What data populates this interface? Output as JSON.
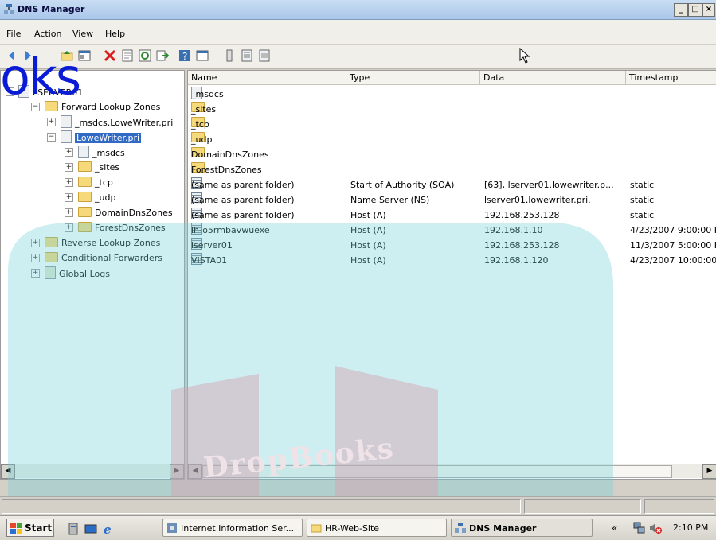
{
  "window": {
    "title": "DNS Manager",
    "minimize": "_",
    "maximize": "□",
    "close": "×"
  },
  "menu": {
    "items": [
      "File",
      "Action",
      "View",
      "Help"
    ]
  },
  "toolbar": {
    "icons": [
      "back-icon",
      "forward-icon",
      "up-folder-icon",
      "show-hide-tree-icon",
      "delete-icon",
      "properties-icon",
      "refresh-icon",
      "export-list-icon",
      "help-icon",
      "console-icon",
      "server-icon",
      "zone-icon",
      "record-icon"
    ]
  },
  "tree": {
    "items": [
      {
        "label": "LSERVER01",
        "expander": "−"
      },
      {
        "label": "Forward Lookup Zones",
        "expander": "−"
      },
      {
        "label": "_msdcs.LoweWriter.pri",
        "expander": "+"
      },
      {
        "label": "LoweWriter.pri",
        "expander": "−"
      },
      {
        "label": "_msdcs",
        "expander": "+"
      },
      {
        "label": "_sites",
        "expander": "+"
      },
      {
        "label": "_tcp",
        "expander": "+"
      },
      {
        "label": "_udp",
        "expander": "+"
      },
      {
        "label": "DomainDnsZones",
        "expander": "+"
      },
      {
        "label": "ForestDnsZones",
        "expander": "+"
      },
      {
        "label": "Reverse Lookup Zones",
        "expander": "+"
      },
      {
        "label": "Conditional Forwarders",
        "expander": "+"
      },
      {
        "label": "Global Logs",
        "expander": "+"
      }
    ]
  },
  "list": {
    "columns": [
      "Name",
      "Type",
      "Data",
      "Timestamp"
    ],
    "rows": [
      {
        "name": "_msdcs",
        "type": "",
        "data": "",
        "timestamp": ""
      },
      {
        "name": "_sites",
        "type": "",
        "data": "",
        "timestamp": ""
      },
      {
        "name": "_tcp",
        "type": "",
        "data": "",
        "timestamp": ""
      },
      {
        "name": "_udp",
        "type": "",
        "data": "",
        "timestamp": ""
      },
      {
        "name": "DomainDnsZones",
        "type": "",
        "data": "",
        "timestamp": ""
      },
      {
        "name": "ForestDnsZones",
        "type": "",
        "data": "",
        "timestamp": ""
      },
      {
        "name": "(same as parent folder)",
        "type": "Start of Authority (SOA)",
        "data": "[63], lserver01.lowewriter.p...",
        "timestamp": "static"
      },
      {
        "name": "(same as parent folder)",
        "type": "Name Server (NS)",
        "data": "lserver01.lowewriter.pri.",
        "timestamp": "static"
      },
      {
        "name": "(same as parent folder)",
        "type": "Host (A)",
        "data": "192.168.253.128",
        "timestamp": "static"
      },
      {
        "name": "lh-o5rmbavwuexe",
        "type": "Host (A)",
        "data": "192.168.1.10",
        "timestamp": "4/23/2007 9:00:00 P"
      },
      {
        "name": "lserver01",
        "type": "Host (A)",
        "data": "192.168.253.128",
        "timestamp": "11/3/2007 5:00:00 P"
      },
      {
        "name": "VISTA01",
        "type": "Host (A)",
        "data": "192.168.1.120",
        "timestamp": "4/23/2007 10:00:00"
      }
    ]
  },
  "scroll": {
    "left": "◀",
    "right": "▶"
  },
  "taskbar": {
    "start": "Start",
    "quicklaunch": [
      "server-manager-icon",
      "show-desktop-icon",
      "internet-explorer-icon"
    ],
    "buttons": [
      "Internet Information Ser...",
      "HR-Web-Site",
      "DNS Manager"
    ],
    "tray_chevron": "«",
    "clock": "2:10 PM"
  },
  "watermark": {
    "text": "oks",
    "logo": "DropBooks"
  }
}
